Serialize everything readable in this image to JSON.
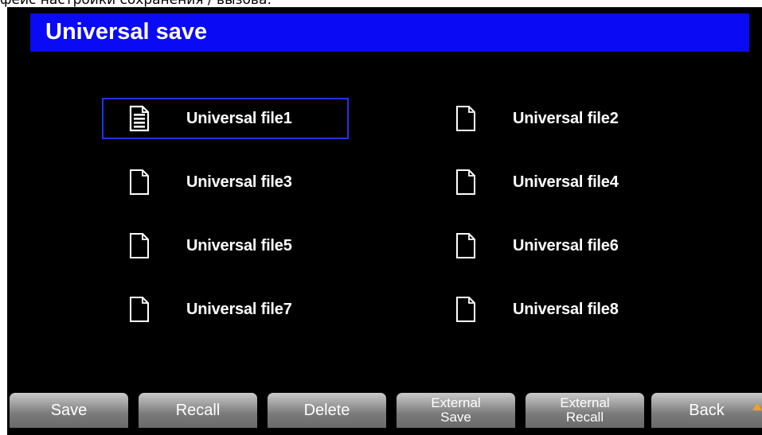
{
  "caption": "фейс настройки сохранения / вызова:",
  "header": {
    "title": "Universal save"
  },
  "files": [
    {
      "label": "Universal file1",
      "icon": "document-with-content-icon",
      "selected": true
    },
    {
      "label": "Universal file2",
      "icon": "blank-document-icon",
      "selected": false
    },
    {
      "label": "Universal file3",
      "icon": "blank-document-icon",
      "selected": false
    },
    {
      "label": "Universal file4",
      "icon": "blank-document-icon",
      "selected": false
    },
    {
      "label": "Universal file5",
      "icon": "blank-document-icon",
      "selected": false
    },
    {
      "label": "Universal file6",
      "icon": "blank-document-icon",
      "selected": false
    },
    {
      "label": "Universal file7",
      "icon": "blank-document-icon",
      "selected": false
    },
    {
      "label": "Universal file8",
      "icon": "blank-document-icon",
      "selected": false
    }
  ],
  "softkeys": [
    {
      "line1": "Save",
      "line2": ""
    },
    {
      "line1": "Recall",
      "line2": ""
    },
    {
      "line1": "Delete",
      "line2": ""
    },
    {
      "line1": "External",
      "line2": "Save"
    },
    {
      "line1": "External",
      "line2": "Recall"
    },
    {
      "line1": "Back",
      "line2": ""
    }
  ],
  "colors": {
    "title_bar": "#0a0af5",
    "selection_border": "#1f35e6",
    "screen_background": "#000000",
    "more_indicator": "#f0a020"
  },
  "indicators": {
    "more_arrow_icon": "triangle-up-icon"
  }
}
